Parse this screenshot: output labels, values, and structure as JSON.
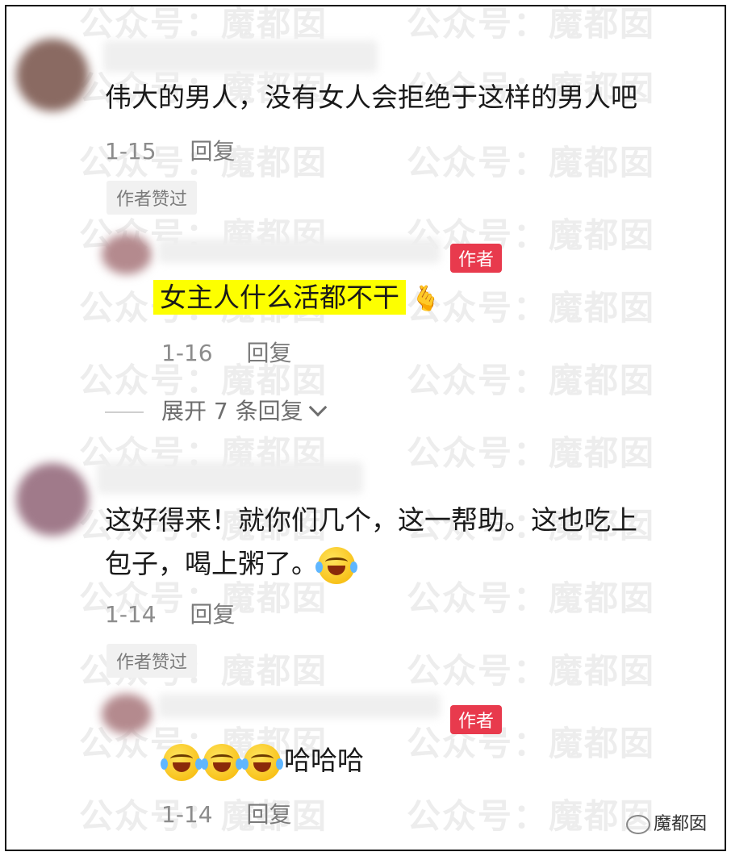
{
  "watermark": {
    "left_text": "公众号：",
    "right_text": "魔都囡"
  },
  "comments": [
    {
      "text": "伟大的男人，没有女人会拒绝于这样的男人吧",
      "date": "1-15",
      "reply_label": "回复",
      "liked_label": "作者赞过",
      "author_reply": {
        "badge": "作者",
        "text": "女主人什么活都不干",
        "emoji": "finger-heart-icon",
        "date": "1-16",
        "reply_label": "回复"
      },
      "expand_label": "展开 7 条回复"
    },
    {
      "text_line1": "这好得来！就你们几个，这一帮助。这也吃上",
      "text_line2": "包子，喝上粥了。",
      "emoji": "laugh-cry-icon",
      "date": "1-14",
      "reply_label": "回复",
      "liked_label": "作者赞过",
      "author_reply": {
        "badge": "作者",
        "text": "哈哈哈",
        "emoji": "laugh-cry-icon",
        "date": "1-14",
        "reply_label": "回复"
      }
    }
  ],
  "brand": {
    "name": "魔都囡",
    "icon": "wechat-icon"
  }
}
